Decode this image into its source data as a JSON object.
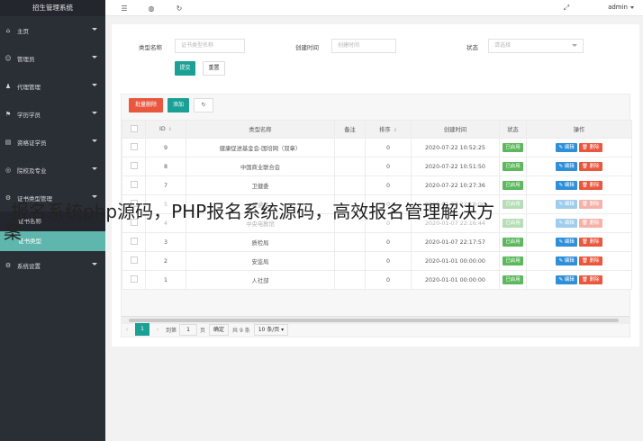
{
  "app_title": "招生管理系统",
  "sidebar": {
    "items": [
      {
        "label": "主页",
        "icon": "home-icon"
      },
      {
        "label": "管理员",
        "icon": "user-icon"
      },
      {
        "label": "代理管理",
        "icon": "agent-icon"
      },
      {
        "label": "学历学员",
        "icon": "graduation-icon"
      },
      {
        "label": "资格证学员",
        "icon": "certificate-icon"
      },
      {
        "label": "院校及专业",
        "icon": "school-icon"
      },
      {
        "label": "证书类型管理",
        "icon": "gear-icon"
      }
    ],
    "sub_items": [
      {
        "label": "证书名称"
      },
      {
        "label": "证书类型"
      }
    ],
    "bottom_item": {
      "label": "系统设置",
      "icon": "settings-icon"
    }
  },
  "header": {
    "user": "admin"
  },
  "search_form": {
    "type_name_label": "类型名称",
    "type_name_placeholder": "证书类型名称",
    "created_label": "创建时间",
    "created_placeholder": "创建时间",
    "status_label": "状态",
    "status_placeholder": "请选择",
    "submit_label": "提交",
    "reset_label": "重置"
  },
  "toolbar": {
    "batch_delete_label": "批量删除",
    "add_label": "添加"
  },
  "table": {
    "columns": [
      "ID",
      "类型名称",
      "备注",
      "排序",
      "创建时间",
      "状态",
      "操作"
    ],
    "status_label": "已启用",
    "edit_label": "编辑",
    "delete_label": "删除",
    "rows": [
      {
        "id": "9",
        "name": "健康促进基金会-国培网（双章）",
        "note": "",
        "sort": "0",
        "created": "2020-07-22 10:52:25"
      },
      {
        "id": "8",
        "name": "中国商业联合会",
        "note": "",
        "sort": "0",
        "created": "2020-07-22 10:51:50"
      },
      {
        "id": "7",
        "name": "卫健委",
        "note": "",
        "sort": "0",
        "created": "2020-07-22 10:27:36"
      },
      {
        "id": "5",
        "name": "普通话",
        "note": "",
        "sort": "0",
        "created": "2020-01-07 22:18:00"
      },
      {
        "id": "4",
        "name": "中央电教馆",
        "note": "",
        "sort": "0",
        "created": "2020-01-07 22:16:44"
      },
      {
        "id": "3",
        "name": "质检局",
        "note": "",
        "sort": "0",
        "created": "2020-01-07 22:17:57"
      },
      {
        "id": "2",
        "name": "安监局",
        "note": "",
        "sort": "0",
        "created": "2020-01-01 00:00:00"
      },
      {
        "id": "1",
        "name": "人社部",
        "note": "",
        "sort": "0",
        "created": "2020-01-01 00:00:00"
      }
    ]
  },
  "pager": {
    "current": "1",
    "goto_label": "到第",
    "page_input": "1",
    "page_unit": "页",
    "confirm_label": "确定",
    "total_label": "共 9 条",
    "page_size": "10 条/页"
  },
  "overlay_text": {
    "line1": "报名系统php源码，PHP报名系统源码，高效报名管理解决方",
    "line2": "案"
  },
  "colors": {
    "sidebar_bg": "#2a2f36",
    "accent": "#1aa094",
    "delete": "#e9573f",
    "edit": "#2f8fd8",
    "enabled": "#5cb85c"
  }
}
